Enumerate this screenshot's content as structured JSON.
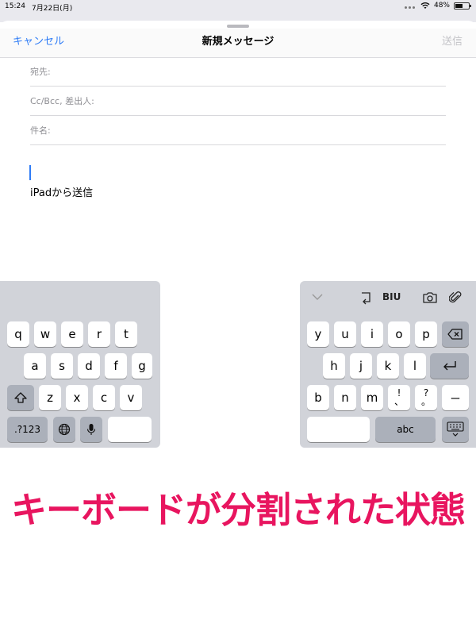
{
  "status_bar": {
    "time": "15:24",
    "date": "7月22日(月)",
    "battery": "48%"
  },
  "nav": {
    "cancel": "キャンセル",
    "title": "新規メッセージ",
    "send": "送信"
  },
  "fields": {
    "to": "宛先:",
    "cc": "Cc/Bcc, 差出人:",
    "subject": "件名:"
  },
  "body": {
    "signature": "iPadから送信"
  },
  "keyboard_left": {
    "row1": [
      "q",
      "w",
      "e",
      "r",
      "t"
    ],
    "row2": [
      "a",
      "s",
      "d",
      "f",
      "g"
    ],
    "row3": [
      "z",
      "x",
      "c",
      "v"
    ],
    "numbers_key": ".?123"
  },
  "keyboard_right": {
    "row1": [
      "y",
      "u",
      "i",
      "o",
      "p"
    ],
    "row2": [
      "h",
      "j",
      "k",
      "l"
    ],
    "row3": [
      "b",
      "n",
      "m"
    ],
    "punct1_top": "!",
    "punct1_bottom": "、",
    "punct2_top": "?",
    "punct2_bottom": "。",
    "dash": "ー",
    "abc_key": "abc",
    "format_label": "BIU"
  },
  "caption": "キーボードが分割された状態",
  "icons": [
    "wifi-icon",
    "battery-icon",
    "shift-icon",
    "globe-icon",
    "microphone-icon",
    "delete-icon",
    "return-icon",
    "keyboard-dismiss-icon",
    "chevron-down-icon",
    "undo-icon",
    "camera-icon",
    "paperclip-icon"
  ],
  "colors": {
    "accent": "#2f7cf6",
    "caption": "#e8155f",
    "keyboard_bg": "#d1d3d9"
  }
}
